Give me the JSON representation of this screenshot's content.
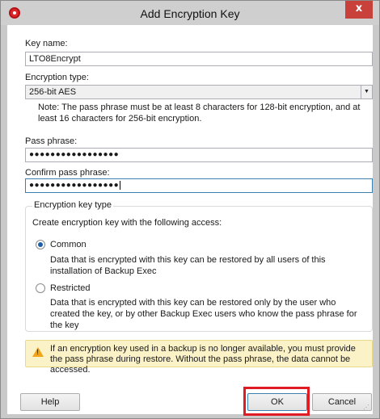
{
  "window": {
    "title": "Add Encryption Key",
    "close_glyph": "x"
  },
  "key_name": {
    "label": "Key name:",
    "value": "LTO8Encrypt"
  },
  "encryption_type": {
    "label": "Encryption type:",
    "selected": "256-bit AES",
    "arrow_glyph": "▼",
    "note": "Note: The pass phrase must be at least 8 characters for 128-bit encryption, and at least 16 characters for 256-bit encryption."
  },
  "pass_phrase": {
    "label": "Pass phrase:",
    "masked_value": "●●●●●●●●●●●●●●●●●"
  },
  "confirm_pass_phrase": {
    "label": "Confirm pass phrase:",
    "masked_value": "●●●●●●●●●●●●●●●●●"
  },
  "key_type": {
    "legend": "Encryption key type",
    "intro": "Create encryption key with the following access:",
    "options": [
      {
        "label": "Common",
        "description": "Data that is encrypted with this key can be restored by all users of this installation of Backup Exec",
        "checked": true
      },
      {
        "label": "Restricted",
        "description": "Data that is encrypted with this key can be restored only by the user who created the key, or by other Backup Exec users who know the pass phrase for the key",
        "checked": false
      }
    ]
  },
  "warning": {
    "text": "If an encryption key used in a backup is no longer available, you must provide the pass phrase during restore.  Without the pass phrase, the data cannot be accessed."
  },
  "buttons": {
    "help": "Help",
    "ok": "OK",
    "cancel": "Cancel"
  },
  "colors": {
    "highlight": "#e01b24",
    "close": "#c8413b",
    "warning_bg": "#fbf2c7",
    "radio_selected": "#1c5ea8"
  }
}
